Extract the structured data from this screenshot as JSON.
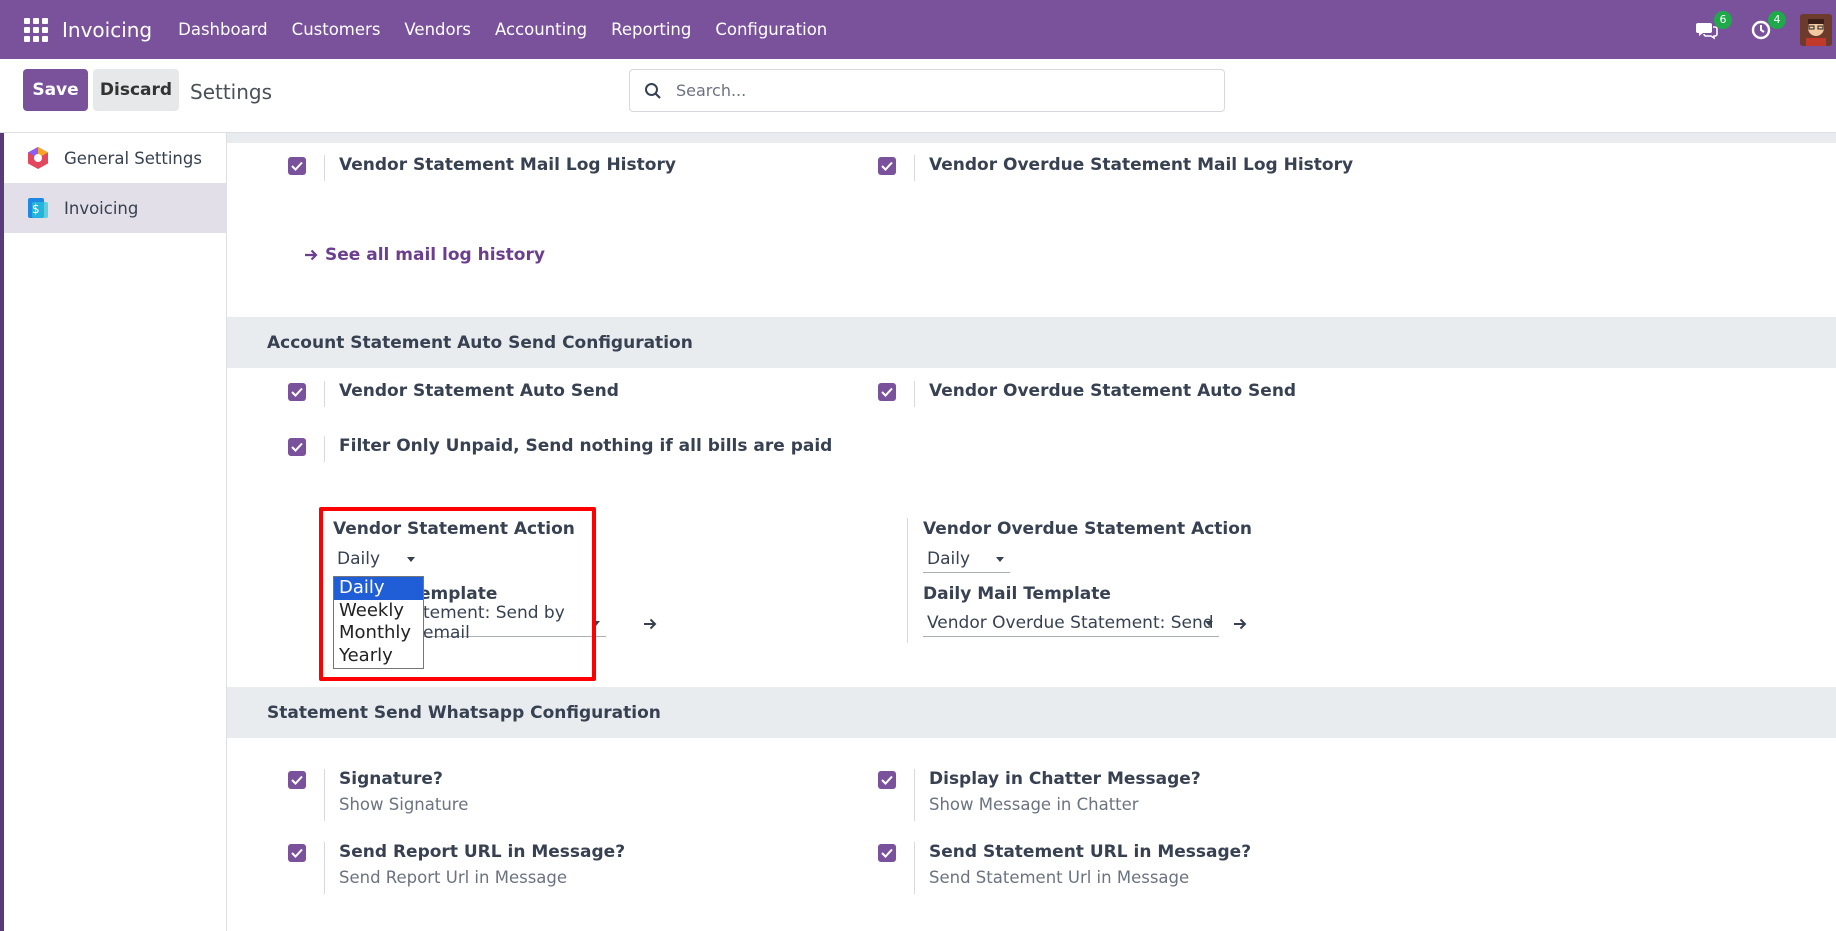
{
  "navbar": {
    "brand": "Invoicing",
    "menu": [
      "Dashboard",
      "Customers",
      "Vendors",
      "Accounting",
      "Reporting",
      "Configuration"
    ],
    "messages_count": "6",
    "activities_count": "4"
  },
  "control": {
    "save_label": "Save",
    "discard_label": "Discard",
    "title": "Settings",
    "search_placeholder": "Search..."
  },
  "sidebar": {
    "items": [
      {
        "label": "General Settings",
        "icon": "general-settings-icon"
      },
      {
        "label": "Invoicing",
        "icon": "invoicing-icon",
        "active": true
      }
    ]
  },
  "mail_log": {
    "vendor_statement_log": "Vendor Statement Mail Log History",
    "vendor_overdue_log": "Vendor Overdue Statement Mail Log History",
    "see_all_link": "See all mail log history"
  },
  "auto_send": {
    "section_title": "Account Statement Auto Send Configuration",
    "vendor_auto_send": "Vendor Statement Auto Send",
    "vendor_overdue_auto_send": "Vendor Overdue Statement Auto Send",
    "filter_unpaid": "Filter Only Unpaid, Send nothing if all bills are paid",
    "vendor_action_label": "Vendor Statement Action",
    "vendor_action_value": "Daily",
    "vendor_template_label_partial": "emplate",
    "vendor_template_value_partial": "tement: Send by email",
    "overdue_action_label": "Vendor Overdue Statement Action",
    "overdue_action_value": "Daily",
    "overdue_template_label": "Daily Mail Template",
    "overdue_template_value": "Vendor Overdue Statement: Send"
  },
  "dropdown": {
    "options": [
      "Daily",
      "Weekly",
      "Monthly",
      "Yearly"
    ],
    "selected": "Daily"
  },
  "whatsapp": {
    "section_title": "Statement Send Whatsapp Configuration",
    "signature_title": "Signature?",
    "signature_desc": "Show Signature",
    "chatter_title": "Display in Chatter Message?",
    "chatter_desc": "Show Message in Chatter",
    "report_url_title": "Send Report URL in Message?",
    "report_url_desc": "Send Report Url in Message",
    "statement_url_title": "Send Statement URL in Message?",
    "statement_url_desc": "Send Statement Url in Message"
  },
  "colors": {
    "brand": "#7a529c",
    "checkbox": "#7a529c",
    "highlight": "#ff0000",
    "dropdown_selected": "#1f5ed6",
    "badge": "#1fa94a"
  }
}
